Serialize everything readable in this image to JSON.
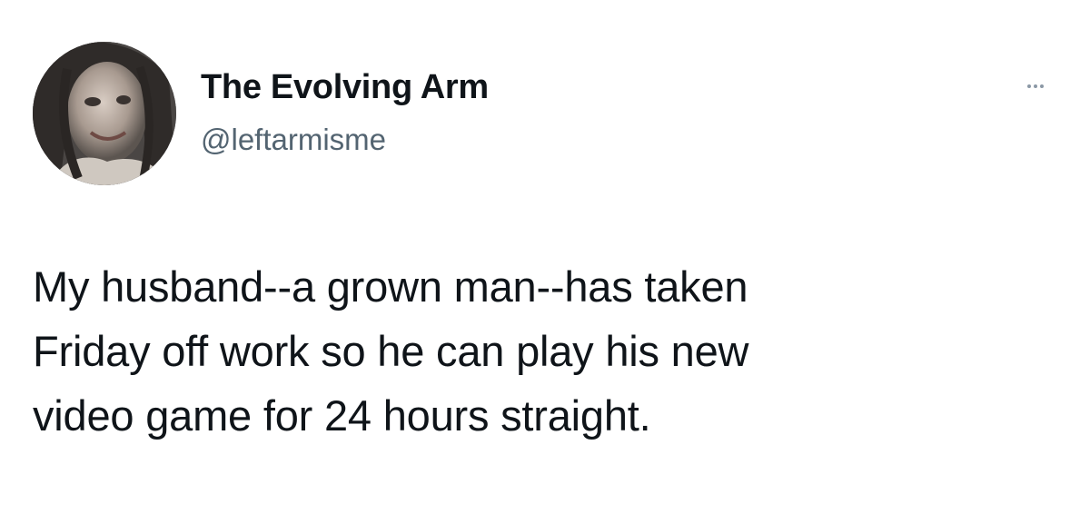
{
  "tweet": {
    "author": {
      "display_name": "The Evolving Arm",
      "handle": "@leftarmisme",
      "avatar_icon": "profile-photo"
    },
    "more_icon": "more-options-icon",
    "text_lines": [
      "My husband--a grown man--has taken",
      "Friday off work so he can play his new",
      "video game for 24 hours straight."
    ]
  },
  "colors": {
    "text_primary": "#0f1419",
    "text_secondary": "#536471",
    "background": "#ffffff"
  }
}
